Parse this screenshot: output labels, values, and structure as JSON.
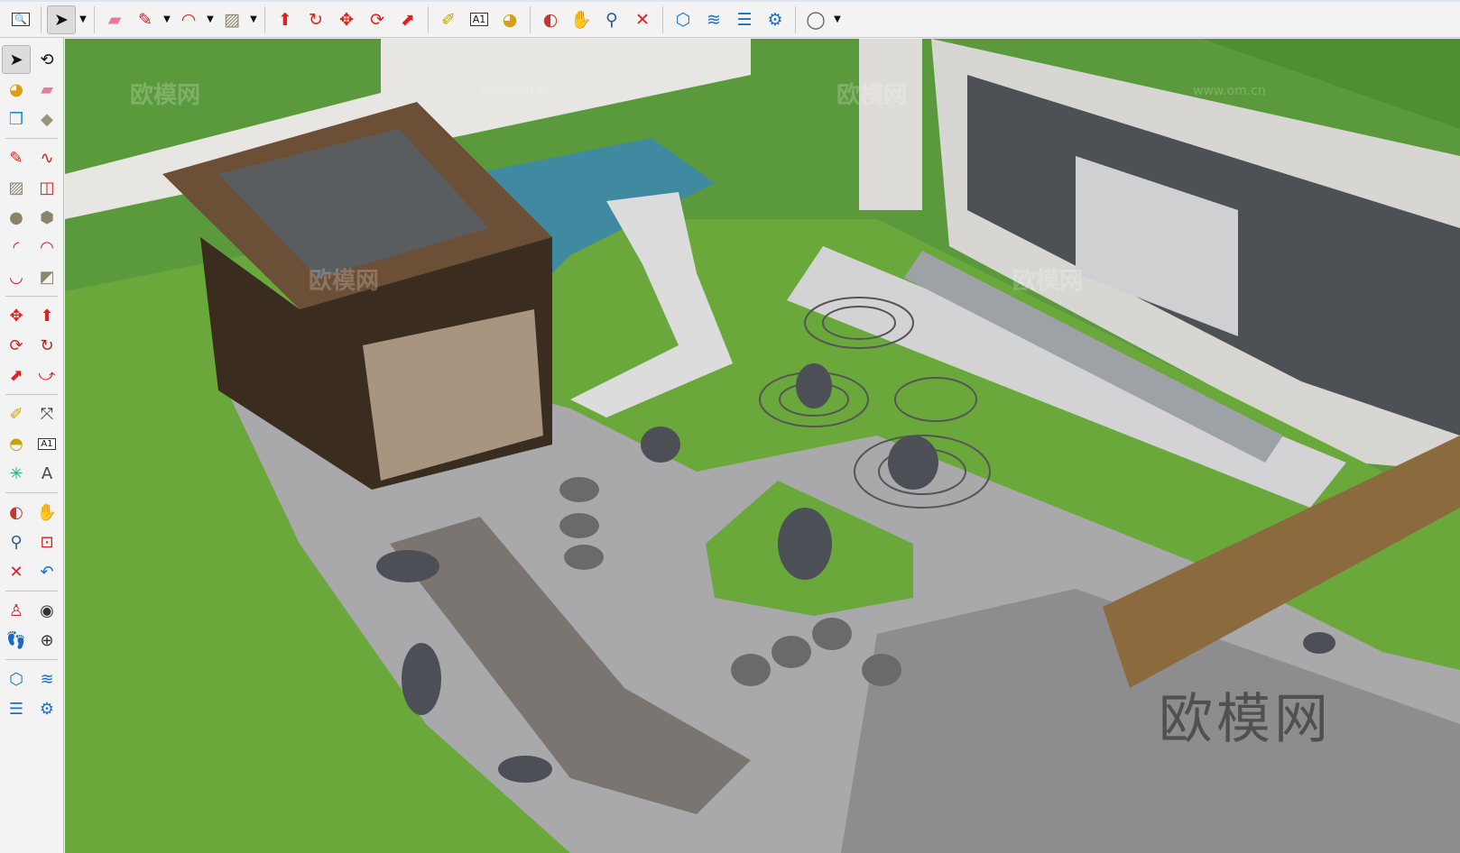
{
  "toolbar": {
    "items": [
      {
        "icon": "zoom-icon",
        "glyph": "🔍",
        "color": "#333"
      },
      {
        "icon": "select-icon",
        "glyph": "➤",
        "color": "#111",
        "selected": true,
        "dropdown": true
      },
      {
        "icon": "eraser-icon",
        "glyph": "▰",
        "color": "#e87a9a"
      },
      {
        "icon": "pencil-icon",
        "glyph": "✎",
        "color": "#c22",
        "dropdown": true
      },
      {
        "icon": "arc-icon",
        "glyph": "◠",
        "color": "#d22",
        "dropdown": true
      },
      {
        "icon": "rectangle-icon",
        "glyph": "▨",
        "color": "#8a846b",
        "dropdown": true
      },
      {
        "icon": "push-pull-icon",
        "glyph": "⬆",
        "color": "#d22"
      },
      {
        "icon": "follow-me-icon",
        "glyph": "↻",
        "color": "#d22"
      },
      {
        "icon": "move-icon",
        "glyph": "✥",
        "color": "#d22"
      },
      {
        "icon": "rotate-icon",
        "glyph": "⟳",
        "color": "#d22"
      },
      {
        "icon": "scale-icon",
        "glyph": "⬈",
        "color": "#d22"
      },
      {
        "icon": "tape-measure-icon",
        "glyph": "✐",
        "color": "#c9a400"
      },
      {
        "icon": "text-icon",
        "glyph": "A1",
        "color": "#111"
      },
      {
        "icon": "paint-bucket-icon",
        "glyph": "◕",
        "color": "#d8a010"
      },
      {
        "icon": "orbit-icon",
        "glyph": "◐",
        "color": "#c33"
      },
      {
        "icon": "pan-icon",
        "glyph": "✋",
        "color": "#d9b98a"
      },
      {
        "icon": "zoom-tool-icon",
        "glyph": "⚲",
        "color": "#2a5c9a"
      },
      {
        "icon": "zoom-extents-icon",
        "glyph": "✕",
        "color": "#d22"
      },
      {
        "icon": "3d-warehouse-icon",
        "glyph": "⬡",
        "color": "#1b6fbf"
      },
      {
        "icon": "extension-warehouse-icon",
        "glyph": "≋",
        "color": "#1b6fbf"
      },
      {
        "icon": "layout-icon",
        "glyph": "☰",
        "color": "#1b6fbf"
      },
      {
        "icon": "extension-manager-icon",
        "glyph": "⚙",
        "color": "#1b6fbf"
      },
      {
        "icon": "account-icon",
        "glyph": "◯",
        "color": "#555",
        "dropdown": true
      }
    ],
    "separators_after": [
      0,
      1,
      5,
      10,
      13,
      17,
      21
    ]
  },
  "leftbar": {
    "groups": [
      [
        [
          "select-icon",
          "➤",
          "#111"
        ],
        [
          "orbit-select-icon",
          "⟲",
          "#111"
        ],
        [
          "paint-bucket-icon",
          "◕",
          "#d8a010"
        ],
        [
          "eraser-icon",
          "▰",
          "#e87a9a"
        ],
        [
          "make-component-icon",
          "❒",
          "#1b8fd6"
        ],
        [
          "tag-icon",
          "◆",
          "#9a9478"
        ]
      ],
      [
        [
          "pencil-icon",
          "✎",
          "#c22"
        ],
        [
          "freehand-icon",
          "∿",
          "#c22"
        ],
        [
          "rectangle-icon",
          "▨",
          "#8a846b"
        ],
        [
          "rotated-rectangle-icon",
          "◫",
          "#c22"
        ],
        [
          "circle-icon",
          "●",
          "#8a846b"
        ],
        [
          "polygon-icon",
          "⬢",
          "#8a846b"
        ],
        [
          "arc-icon",
          "◜",
          "#c22"
        ],
        [
          "two-point-arc-icon",
          "◠",
          "#c22"
        ],
        [
          "three-point-arc-icon",
          "◡",
          "#c22"
        ],
        [
          "pie-icon",
          "◩",
          "#8a846b"
        ]
      ],
      [
        [
          "move-icon",
          "✥",
          "#d22"
        ],
        [
          "push-pull-icon",
          "⬆",
          "#d22"
        ],
        [
          "rotate-icon",
          "⟳",
          "#d22"
        ],
        [
          "follow-me-icon",
          "↻",
          "#b22"
        ],
        [
          "scale-icon",
          "⬈",
          "#d22"
        ],
        [
          "offset-icon",
          "⤻",
          "#d22"
        ]
      ],
      [
        [
          "tape-measure-icon",
          "✐",
          "#c9a400"
        ],
        [
          "dimension-icon",
          "⤧",
          "#333"
        ],
        [
          "protractor-icon",
          "◓",
          "#c9a400"
        ],
        [
          "text-icon",
          "A1",
          "#111"
        ],
        [
          "axes-icon",
          "✳",
          "#2a7"
        ],
        [
          "3d-text-icon",
          "A",
          "#444"
        ]
      ],
      [
        [
          "orbit-icon",
          "◐",
          "#c33"
        ],
        [
          "pan-icon",
          "✋",
          "#d9b98a"
        ],
        [
          "zoom-icon",
          "⚲",
          "#2a5c9a"
        ],
        [
          "zoom-window-icon",
          "⊡",
          "#c22"
        ],
        [
          "zoom-extents-icon",
          "✕",
          "#d22"
        ],
        [
          "previous-view-icon",
          "↶",
          "#1b6fbf"
        ]
      ],
      [
        [
          "position-camera-icon",
          "♙",
          "#c22"
        ],
        [
          "look-around-icon",
          "◉",
          "#333"
        ],
        [
          "walk-icon",
          "👣",
          "#111"
        ],
        [
          "section-plane-icon",
          "⊕",
          "#333"
        ]
      ],
      [
        [
          "3d-warehouse-icon",
          "⬡",
          "#1b6fbf"
        ],
        [
          "extension-warehouse-icon",
          "≋",
          "#1b6fbf"
        ],
        [
          "layout-icon",
          "☰",
          "#1b6fbf"
        ],
        [
          "extension-manager-icon",
          "⚙",
          "#1b6fbf"
        ]
      ]
    ]
  },
  "viewport": {
    "watermark": "欧模网",
    "watermark_url": "www.om.cn"
  }
}
